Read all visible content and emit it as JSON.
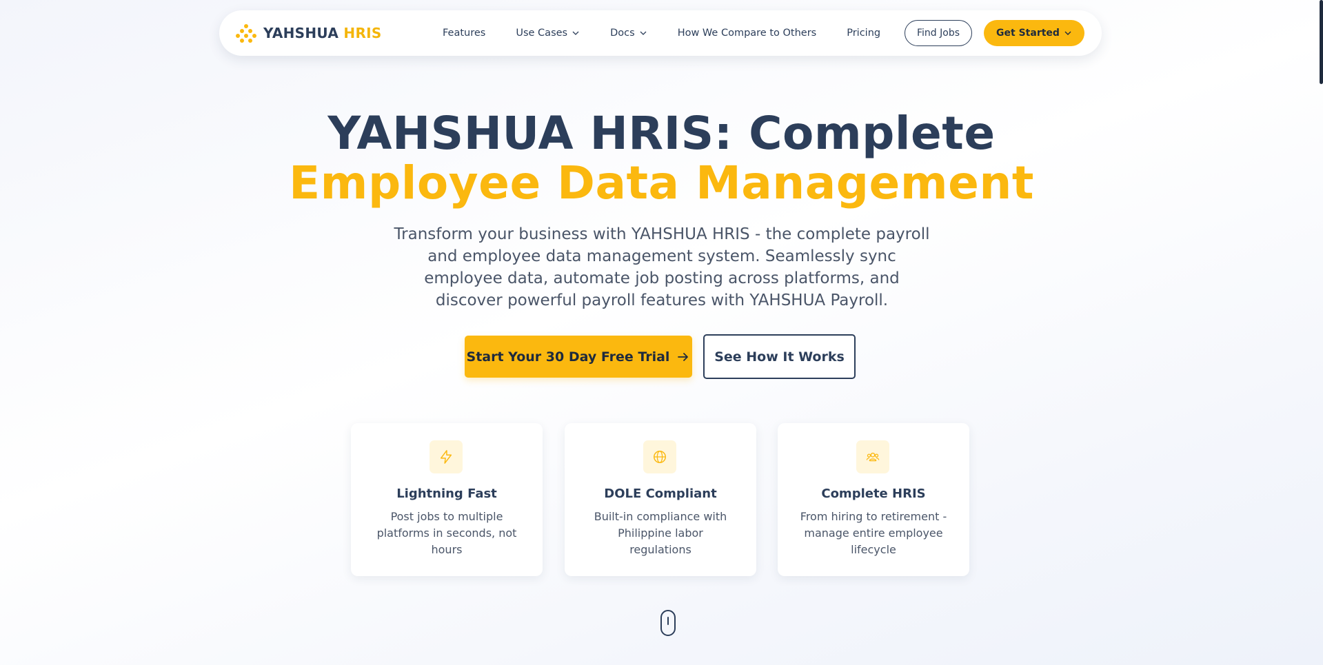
{
  "brand": {
    "name_part1": "YAHSHUA",
    "name_part2": "HRIS",
    "logo_icon": "diamond-dots-logo-icon",
    "accent_color": "#fbb80f",
    "dark_color": "#2c3e5a"
  },
  "nav": {
    "links": [
      {
        "label": "Features",
        "has_dropdown": false
      },
      {
        "label": "Use Cases",
        "has_dropdown": true
      },
      {
        "label": "Docs",
        "has_dropdown": true
      },
      {
        "label": "How We Compare to Others",
        "has_dropdown": false
      },
      {
        "label": "Pricing",
        "has_dropdown": false
      }
    ],
    "find_jobs": "Find Jobs",
    "get_started": "Get Started"
  },
  "hero": {
    "title_line1": "YAHSHUA HRIS: Complete",
    "title_line2": "Employee Data Management",
    "subtitle": "Transform your business with YAHSHUA HRIS - the complete payroll and employee data management system. Seamlessly sync employee data, automate job posting across platforms, and discover powerful payroll features with YAHSHUA Payroll.",
    "primary_cta": "Start Your 30 Day Free Trial",
    "secondary_cta": "See How It Works"
  },
  "features": [
    {
      "icon": "lightning-icon",
      "title": "Lightning Fast",
      "description": "Post jobs to multiple platforms in seconds, not hours"
    },
    {
      "icon": "globe-icon",
      "title": "DOLE Compliant",
      "description": "Built-in compliance with Philippine labor regulations"
    },
    {
      "icon": "users-icon",
      "title": "Complete HRIS",
      "description": "From hiring to retirement - manage entire employee lifecycle"
    }
  ]
}
